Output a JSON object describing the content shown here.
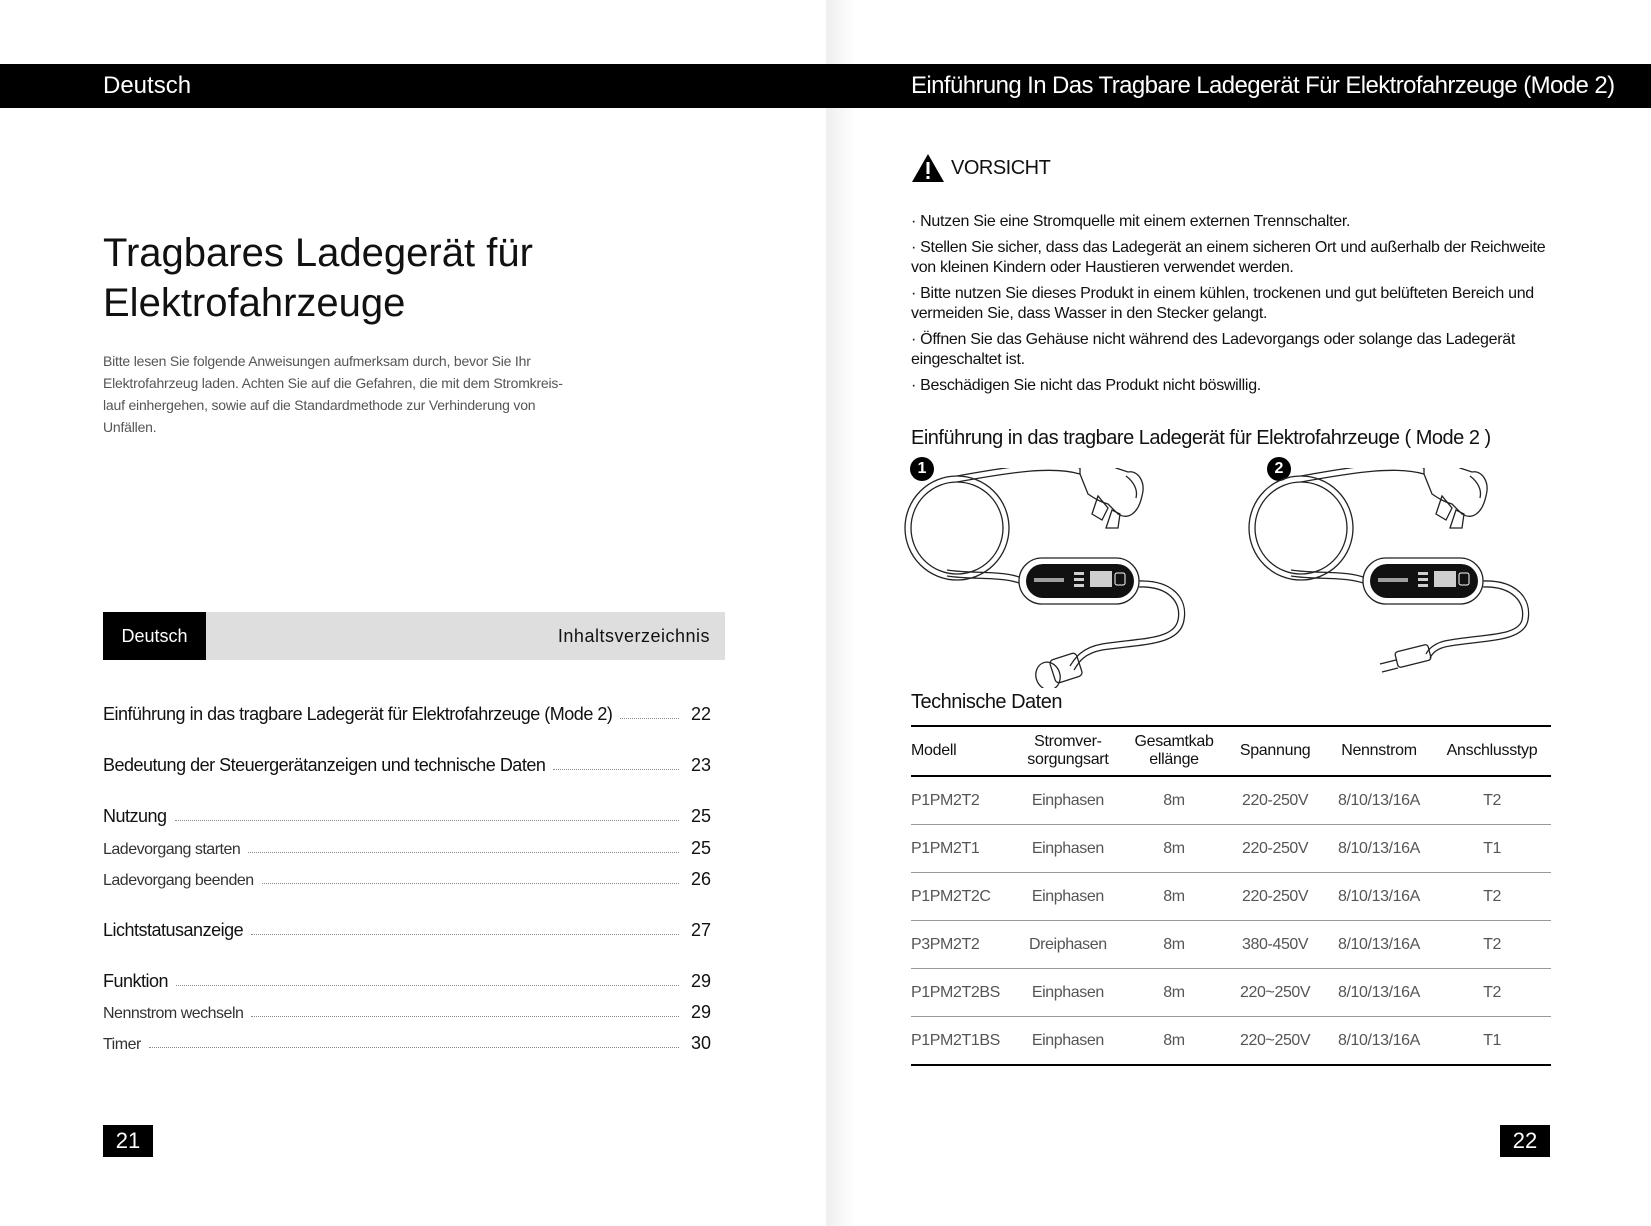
{
  "left_page": {
    "header": "Deutsch",
    "title_line1": "Tragbares Ladegerät für",
    "title_line2": "Elektrofahrzeuge",
    "intro_line1": "Bitte lesen Sie folgende Anweisungen aufmerksam durch, bevor Sie Ihr",
    "intro_line2": "Elektrofahrzeug laden. Achten Sie auf die Gefahren, die mit dem Stromkreis-",
    "intro_line3": "lauf einhergehen, sowie auf die Standardmethode zur Verhinderung von",
    "intro_line4": "Unfällen.",
    "toc": {
      "tab": "Deutsch",
      "title": "Inhaltsverzeichnis",
      "entries": [
        {
          "label": "Einführung in das tragbare Ladegerät für Elektrofahrzeuge (Mode 2)",
          "page": "22"
        },
        {
          "label": "Bedeutung der Steuergerätanzeigen und technische Daten",
          "page": "23"
        },
        {
          "label": "Nutzung",
          "page": "25"
        },
        {
          "label": "Ladevorgang starten",
          "page": "25"
        },
        {
          "label": "Ladevorgang beenden",
          "page": "26"
        },
        {
          "label": "Lichtstatusanzeige",
          "page": "27"
        },
        {
          "label": "Funktion",
          "page": "29"
        },
        {
          "label": "Nennstrom wechseln",
          "page": "29"
        },
        {
          "label": "Timer",
          "page": "30"
        }
      ]
    },
    "page_number": "21"
  },
  "right_page": {
    "header": "Einführung In Das Tragbare Ladegerät Für Elektrofahrzeuge (Mode 2)",
    "caution": {
      "label": "VORSICHT",
      "icon": "warning-triangle-icon",
      "items": [
        "· Nutzen Sie eine Stromquelle mit einem externen Trennschalter.",
        "· Stellen Sie sicher, dass das Ladegerät an einem sicheren Ort und außerhalb der Reichweite von kleinen Kindern oder Haustieren verwendet werden.",
        "· Bitte nutzen Sie dieses Produkt in einem kühlen, trockenen und gut belüfteten Bereich und vermeiden Sie, dass Wasser in den Stecker gelangt.",
        "· Öffnen Sie das Gehäuse nicht während des Ladevorgangs oder solange das Ladegerät eingeschaltet ist.",
        "· Beschädigen Sie nicht das Produkt nicht böswillig."
      ]
    },
    "intro_subtitle": "Einführung in das tragbare Ladegerät für Elektrofahrzeuge ( Mode 2 )",
    "variants": [
      {
        "badge": "1",
        "plug": "cee-plug"
      },
      {
        "badge": "2",
        "plug": "schuko-plug"
      }
    ],
    "tech": {
      "title": "Technische Daten",
      "columns": [
        {
          "line1": "Modell",
          "line2": ""
        },
        {
          "line1": "Stromver-",
          "line2": "sorgungsart"
        },
        {
          "line1": "Gesamtkab",
          "line2": "ellänge"
        },
        {
          "line1": "Spannung",
          "line2": ""
        },
        {
          "line1": "Nennstrom",
          "line2": ""
        },
        {
          "line1": "Anschlusstyp",
          "line2": ""
        }
      ],
      "rows": [
        [
          "P1PM2T2",
          "Einphasen",
          "8m",
          "220-250V",
          "8/10/13/16A",
          "T2"
        ],
        [
          "P1PM2T1",
          "Einphasen",
          "8m",
          "220-250V",
          "8/10/13/16A",
          "T1"
        ],
        [
          "P1PM2T2C",
          "Einphasen",
          "8m",
          "220-250V",
          "8/10/13/16A",
          "T2"
        ],
        [
          "P3PM2T2",
          "Dreiphasen",
          "8m",
          "380-450V",
          "8/10/13/16A",
          "T2"
        ],
        [
          "P1PM2T2BS",
          "Einphasen",
          "8m",
          "220~250V",
          "8/10/13/16A",
          "T2"
        ],
        [
          "P1PM2T1BS",
          "Einphasen",
          "8m",
          "220~250V",
          "8/10/13/16A",
          "T1"
        ]
      ]
    },
    "page_number": "22"
  }
}
